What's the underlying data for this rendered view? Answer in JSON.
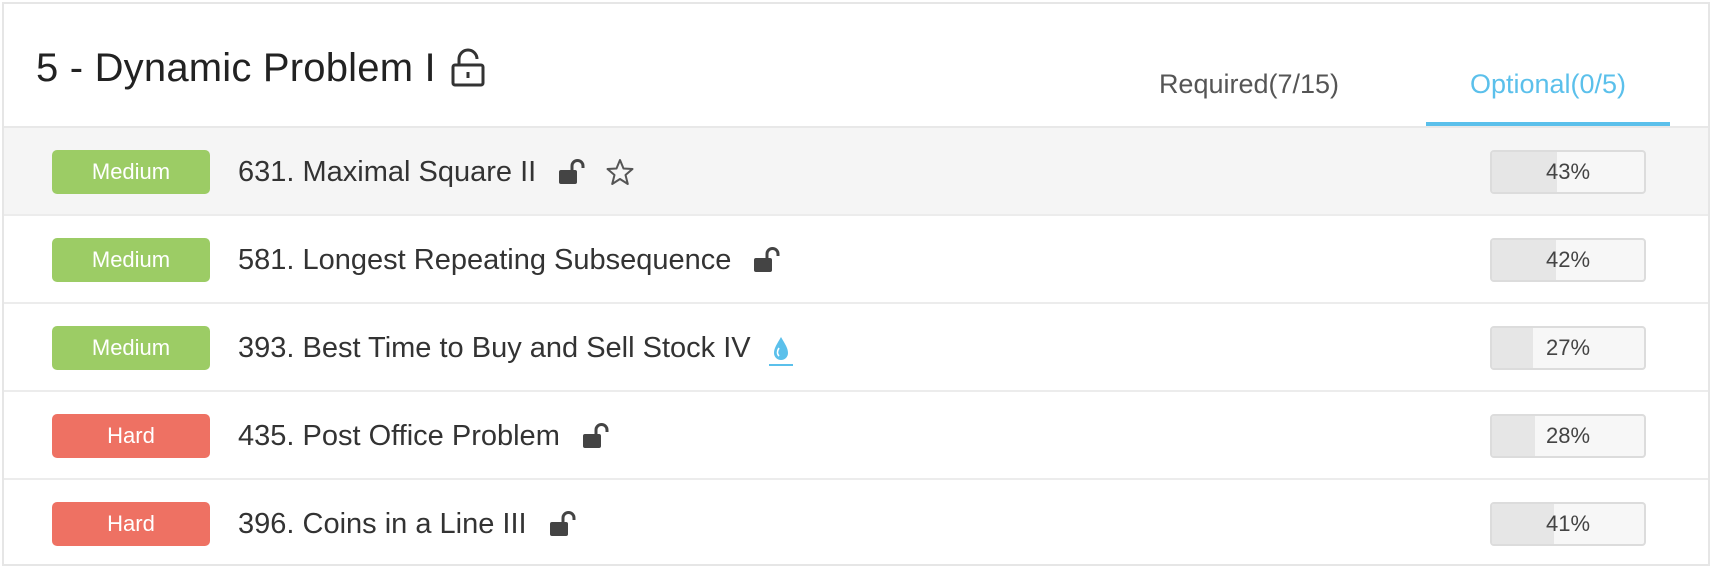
{
  "header": {
    "title": "5 - Dynamic Problem I",
    "tabs": [
      {
        "label": "Required(7/15)",
        "active": false
      },
      {
        "label": "Optional(0/5)",
        "active": true
      }
    ]
  },
  "colors": {
    "accent": "#5bc0eb",
    "medium": "#9ccc65",
    "hard": "#ee7163"
  },
  "problems": [
    {
      "difficulty": "Medium",
      "title": "631. Maximal Square II",
      "icon": "lock-open-icon",
      "starred_icon": "star-icon",
      "percent": "43%",
      "progress": 0.43
    },
    {
      "difficulty": "Medium",
      "title": "581. Longest Repeating Subsequence",
      "icon": "lock-open-icon",
      "percent": "42%",
      "progress": 0.42
    },
    {
      "difficulty": "Medium",
      "title": "393. Best Time to Buy and Sell Stock IV",
      "icon": "drop-icon",
      "percent": "27%",
      "progress": 0.27
    },
    {
      "difficulty": "Hard",
      "title": "435. Post Office Problem",
      "icon": "lock-open-icon",
      "percent": "28%",
      "progress": 0.28
    },
    {
      "difficulty": "Hard",
      "title": "396. Coins in a Line III",
      "icon": "lock-open-icon",
      "percent": "41%",
      "progress": 0.41
    }
  ]
}
